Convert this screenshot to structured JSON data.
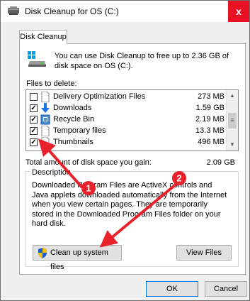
{
  "window": {
    "title": "Disk Cleanup for OS (C:)",
    "close_glyph": "x"
  },
  "tab": {
    "label": "Disk Cleanup"
  },
  "intro": {
    "text": "You can use Disk Cleanup to free up to 2.36 GB of disk space on OS (C:)."
  },
  "files_to_delete": {
    "label": "Files to delete:",
    "items": [
      {
        "name": "Delivery Optimization Files",
        "size": "273 MB",
        "checked": false,
        "icon": "file-icon"
      },
      {
        "name": "Downloads",
        "size": "1.59 GB",
        "checked": true,
        "icon": "download-arrow-icon"
      },
      {
        "name": "Recycle Bin",
        "size": "2.19 MB",
        "checked": true,
        "icon": "recycle-bin-icon"
      },
      {
        "name": "Temporary files",
        "size": "13.3 MB",
        "checked": true,
        "icon": "file-icon"
      },
      {
        "name": "Thumbnails",
        "size": "496 MB",
        "checked": true,
        "icon": "file-icon"
      }
    ]
  },
  "total": {
    "label": "Total amount of disk space you gain:",
    "value": "2.09 GB"
  },
  "description": {
    "title": "Description",
    "text": "Downloaded Program Files are ActiveX controls and Java applets downloaded automatically from the Internet when you view certain pages. They are temporarily stored in the Downloaded Program Files folder on your hard disk."
  },
  "buttons": {
    "cleanup": "Clean up system files",
    "view_files": "View Files",
    "ok": "OK",
    "cancel": "Cancel"
  },
  "annotations": {
    "marker_1": "1",
    "marker_2": "2",
    "color": "#e8212a"
  }
}
